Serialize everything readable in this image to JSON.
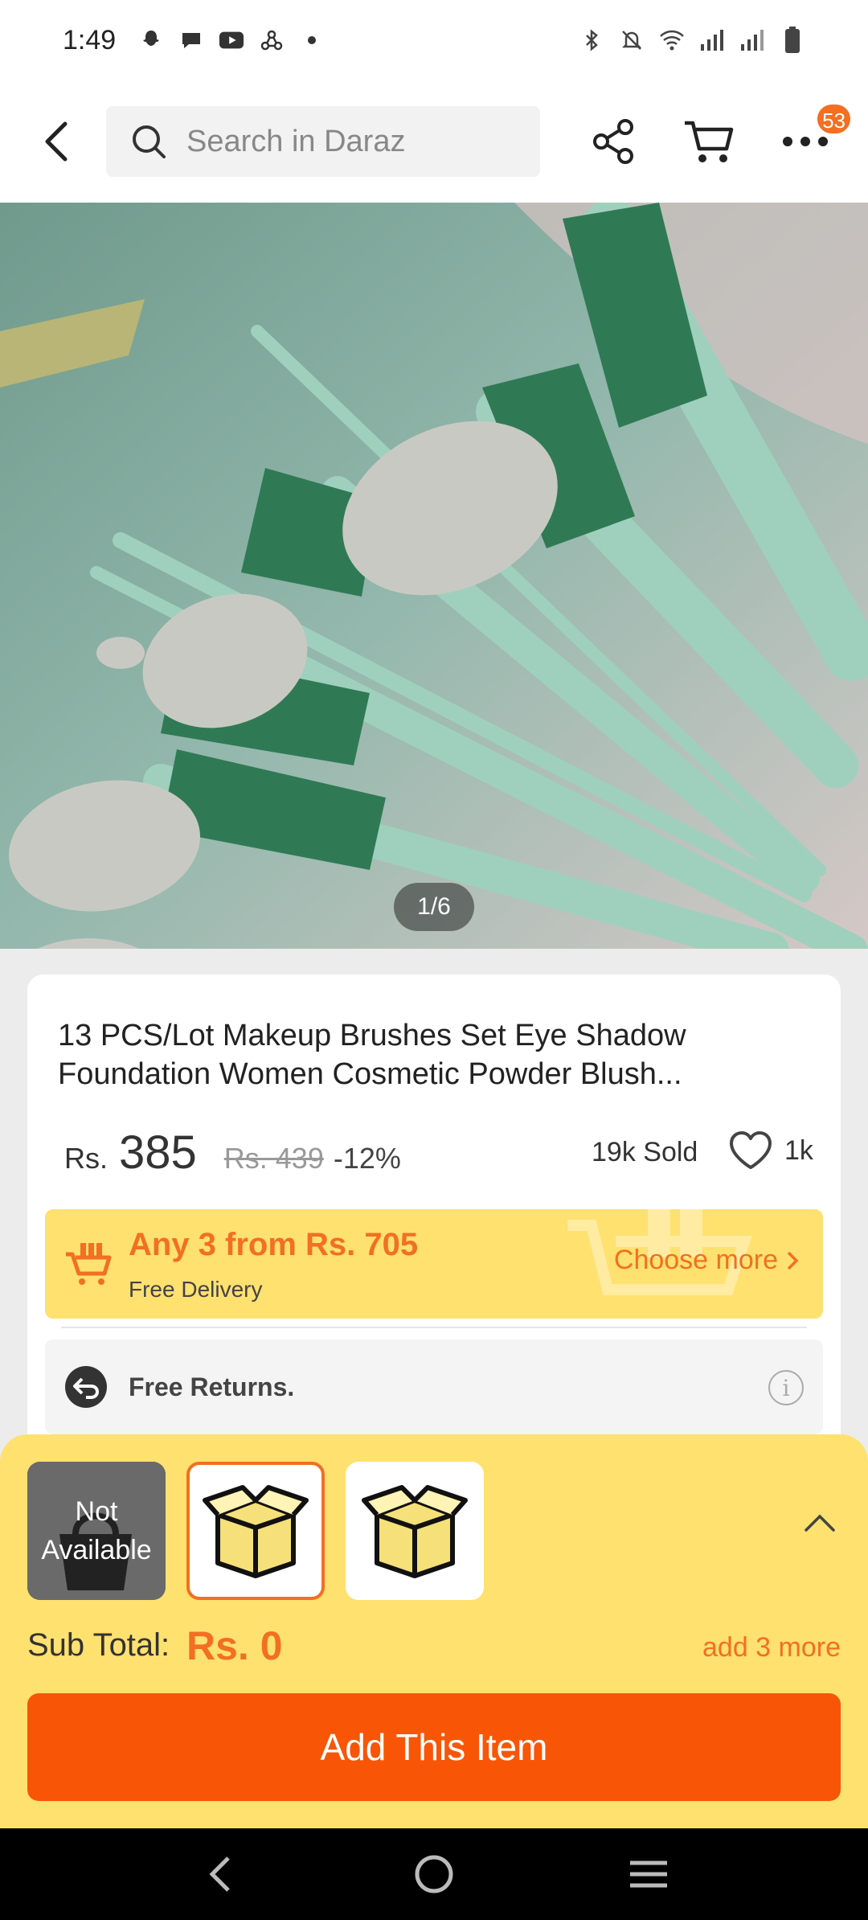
{
  "status_bar": {
    "time": "1:49",
    "left_icons": [
      "snapchat-icon",
      "chat-icon",
      "youtube-icon",
      "network-icon",
      "dot-icon"
    ],
    "right_icons": [
      "bluetooth-icon",
      "mute-icon",
      "wifi-icon",
      "signal-icon",
      "signal-icon",
      "battery-icon"
    ]
  },
  "nav": {
    "search_placeholder": "Search in Daraz",
    "more_badge": "53"
  },
  "gallery": {
    "counter": "1/6"
  },
  "product": {
    "title": "13 PCS/Lot Makeup Brushes Set Eye Shadow Foundation Women Cosmetic Powder Blush...",
    "currency": "Rs.",
    "price": "385",
    "original_price": "Rs. 439",
    "discount": "-12%",
    "sold": "19k Sold",
    "wishlist_count": "1k"
  },
  "promo": {
    "title": "Any 3 from Rs. 705",
    "subtitle": "Free Delivery",
    "choose_more": "Choose more"
  },
  "returns": {
    "label": "Free Returns."
  },
  "sheet": {
    "not_available_line1": "Not",
    "not_available_line2": "Available",
    "subtotal_label": "Sub Total:",
    "subtotal_value": "Rs. 0",
    "add_more": "add 3 more",
    "add_button": "Add This Item"
  },
  "colors": {
    "accent": "#f36f21",
    "button": "#f85606",
    "sheet_bg": "#ffe170"
  }
}
